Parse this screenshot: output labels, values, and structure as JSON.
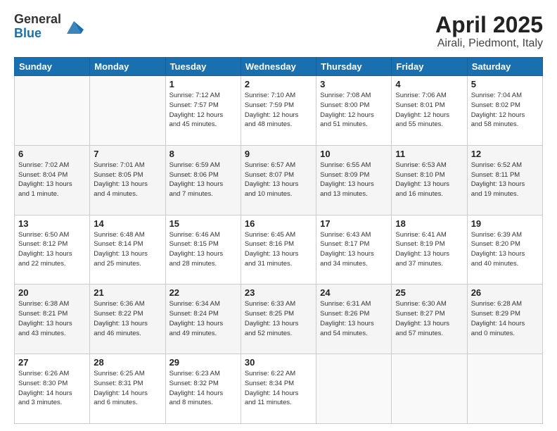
{
  "header": {
    "logo_general": "General",
    "logo_blue": "Blue",
    "title": "April 2025",
    "location": "Airali, Piedmont, Italy"
  },
  "weekdays": [
    "Sunday",
    "Monday",
    "Tuesday",
    "Wednesday",
    "Thursday",
    "Friday",
    "Saturday"
  ],
  "weeks": [
    [
      {
        "day": "",
        "info": ""
      },
      {
        "day": "",
        "info": ""
      },
      {
        "day": "1",
        "info": "Sunrise: 7:12 AM\nSunset: 7:57 PM\nDaylight: 12 hours\nand 45 minutes."
      },
      {
        "day": "2",
        "info": "Sunrise: 7:10 AM\nSunset: 7:59 PM\nDaylight: 12 hours\nand 48 minutes."
      },
      {
        "day": "3",
        "info": "Sunrise: 7:08 AM\nSunset: 8:00 PM\nDaylight: 12 hours\nand 51 minutes."
      },
      {
        "day": "4",
        "info": "Sunrise: 7:06 AM\nSunset: 8:01 PM\nDaylight: 12 hours\nand 55 minutes."
      },
      {
        "day": "5",
        "info": "Sunrise: 7:04 AM\nSunset: 8:02 PM\nDaylight: 12 hours\nand 58 minutes."
      }
    ],
    [
      {
        "day": "6",
        "info": "Sunrise: 7:02 AM\nSunset: 8:04 PM\nDaylight: 13 hours\nand 1 minute."
      },
      {
        "day": "7",
        "info": "Sunrise: 7:01 AM\nSunset: 8:05 PM\nDaylight: 13 hours\nand 4 minutes."
      },
      {
        "day": "8",
        "info": "Sunrise: 6:59 AM\nSunset: 8:06 PM\nDaylight: 13 hours\nand 7 minutes."
      },
      {
        "day": "9",
        "info": "Sunrise: 6:57 AM\nSunset: 8:07 PM\nDaylight: 13 hours\nand 10 minutes."
      },
      {
        "day": "10",
        "info": "Sunrise: 6:55 AM\nSunset: 8:09 PM\nDaylight: 13 hours\nand 13 minutes."
      },
      {
        "day": "11",
        "info": "Sunrise: 6:53 AM\nSunset: 8:10 PM\nDaylight: 13 hours\nand 16 minutes."
      },
      {
        "day": "12",
        "info": "Sunrise: 6:52 AM\nSunset: 8:11 PM\nDaylight: 13 hours\nand 19 minutes."
      }
    ],
    [
      {
        "day": "13",
        "info": "Sunrise: 6:50 AM\nSunset: 8:12 PM\nDaylight: 13 hours\nand 22 minutes."
      },
      {
        "day": "14",
        "info": "Sunrise: 6:48 AM\nSunset: 8:14 PM\nDaylight: 13 hours\nand 25 minutes."
      },
      {
        "day": "15",
        "info": "Sunrise: 6:46 AM\nSunset: 8:15 PM\nDaylight: 13 hours\nand 28 minutes."
      },
      {
        "day": "16",
        "info": "Sunrise: 6:45 AM\nSunset: 8:16 PM\nDaylight: 13 hours\nand 31 minutes."
      },
      {
        "day": "17",
        "info": "Sunrise: 6:43 AM\nSunset: 8:17 PM\nDaylight: 13 hours\nand 34 minutes."
      },
      {
        "day": "18",
        "info": "Sunrise: 6:41 AM\nSunset: 8:19 PM\nDaylight: 13 hours\nand 37 minutes."
      },
      {
        "day": "19",
        "info": "Sunrise: 6:39 AM\nSunset: 8:20 PM\nDaylight: 13 hours\nand 40 minutes."
      }
    ],
    [
      {
        "day": "20",
        "info": "Sunrise: 6:38 AM\nSunset: 8:21 PM\nDaylight: 13 hours\nand 43 minutes."
      },
      {
        "day": "21",
        "info": "Sunrise: 6:36 AM\nSunset: 8:22 PM\nDaylight: 13 hours\nand 46 minutes."
      },
      {
        "day": "22",
        "info": "Sunrise: 6:34 AM\nSunset: 8:24 PM\nDaylight: 13 hours\nand 49 minutes."
      },
      {
        "day": "23",
        "info": "Sunrise: 6:33 AM\nSunset: 8:25 PM\nDaylight: 13 hours\nand 52 minutes."
      },
      {
        "day": "24",
        "info": "Sunrise: 6:31 AM\nSunset: 8:26 PM\nDaylight: 13 hours\nand 54 minutes."
      },
      {
        "day": "25",
        "info": "Sunrise: 6:30 AM\nSunset: 8:27 PM\nDaylight: 13 hours\nand 57 minutes."
      },
      {
        "day": "26",
        "info": "Sunrise: 6:28 AM\nSunset: 8:29 PM\nDaylight: 14 hours\nand 0 minutes."
      }
    ],
    [
      {
        "day": "27",
        "info": "Sunrise: 6:26 AM\nSunset: 8:30 PM\nDaylight: 14 hours\nand 3 minutes."
      },
      {
        "day": "28",
        "info": "Sunrise: 6:25 AM\nSunset: 8:31 PM\nDaylight: 14 hours\nand 6 minutes."
      },
      {
        "day": "29",
        "info": "Sunrise: 6:23 AM\nSunset: 8:32 PM\nDaylight: 14 hours\nand 8 minutes."
      },
      {
        "day": "30",
        "info": "Sunrise: 6:22 AM\nSunset: 8:34 PM\nDaylight: 14 hours\nand 11 minutes."
      },
      {
        "day": "",
        "info": ""
      },
      {
        "day": "",
        "info": ""
      },
      {
        "day": "",
        "info": ""
      }
    ]
  ]
}
